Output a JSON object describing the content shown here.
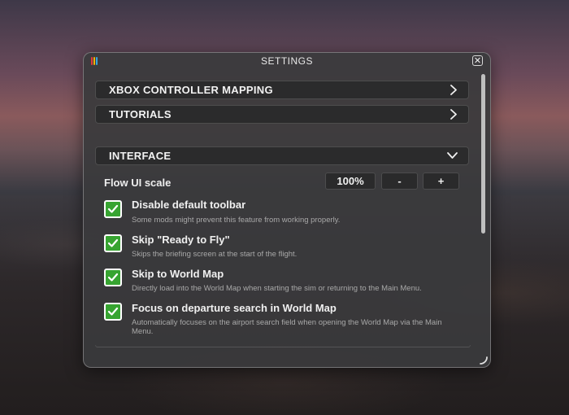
{
  "window": {
    "title": "SETTINGS",
    "close_glyph": "✕",
    "logo_colors": [
      "#e23b3b",
      "#f0b400",
      "#35a7e0"
    ]
  },
  "sections": [
    {
      "label": "XBOX CONTROLLER MAPPING",
      "state": "collapsed",
      "icon": "chevron-right-icon"
    },
    {
      "label": "TUTORIALS",
      "state": "collapsed",
      "icon": "chevron-right-icon"
    },
    {
      "label": "INTERFACE",
      "state": "expanded",
      "icon": "chevron-down-icon"
    }
  ],
  "interface": {
    "flow_ui_scale": {
      "label": "Flow UI scale",
      "value": "100%",
      "decrease_label": "-",
      "increase_label": "+"
    },
    "options": [
      {
        "title": "Disable default toolbar",
        "description": "Some mods might prevent this feature from working properly.",
        "checked": true
      },
      {
        "title": "Skip \"Ready to Fly\"",
        "description": "Skips the briefing screen at the start of the flight.",
        "checked": true
      },
      {
        "title": "Skip to World Map",
        "description": "Directly load into the World Map when starting the sim or returning to the Main Menu.",
        "checked": true
      },
      {
        "title": "Focus on departure search in World Map",
        "description": "Automatically focuses on the airport search field when opening the World Map via the Main Menu.",
        "checked": true
      }
    ]
  },
  "colors": {
    "checkbox_green": "#37a431",
    "panel_bg": "#3a3a3c",
    "bar_bg": "#2b2b2c"
  }
}
